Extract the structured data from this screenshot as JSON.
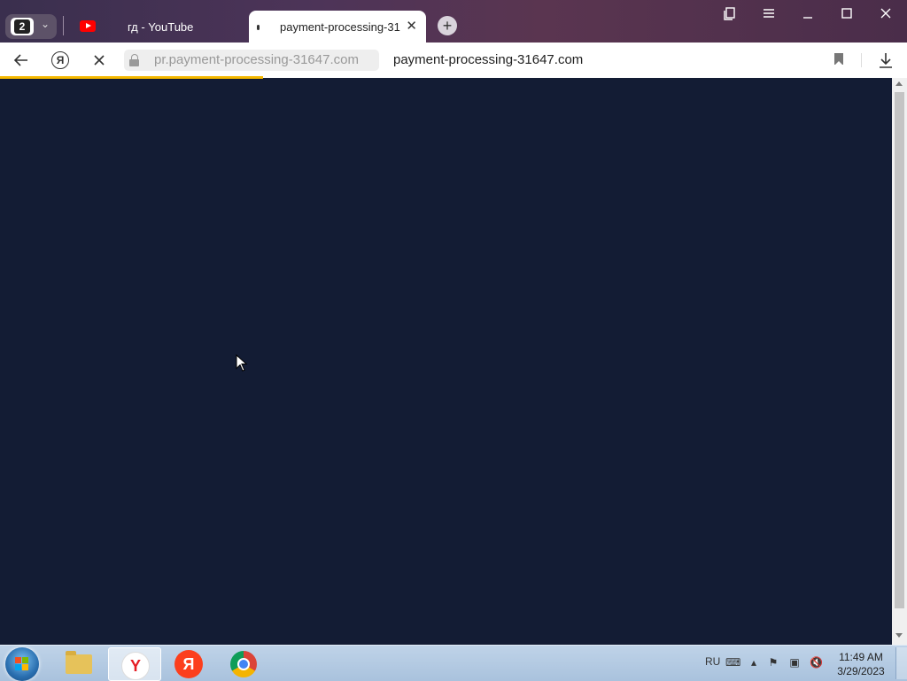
{
  "browser": {
    "tab_count": "2",
    "tabs": [
      {
        "label": "гд - YouTube",
        "active": false
      },
      {
        "label": "payment-processing-31",
        "active": true
      }
    ],
    "new_tab_symbol": "+",
    "window_controls": [
      "tab-manager-icon",
      "menu-icon",
      "minimize-icon",
      "maximize-icon",
      "close-icon"
    ]
  },
  "toolbar": {
    "url": "pr.payment-processing-31647.com",
    "page_title": "payment-processing-31647.com",
    "loading_progress": 0.29,
    "accent_color": "#f5b800"
  },
  "content": {
    "background_color": "#131c34"
  },
  "taskbar": {
    "apps": [
      "start-button",
      "explorer-icon",
      "yandex-browser-icon",
      "yandex-icon",
      "chrome-icon"
    ],
    "language": "RU",
    "time": "11:49 AM",
    "date": "3/29/2023"
  }
}
